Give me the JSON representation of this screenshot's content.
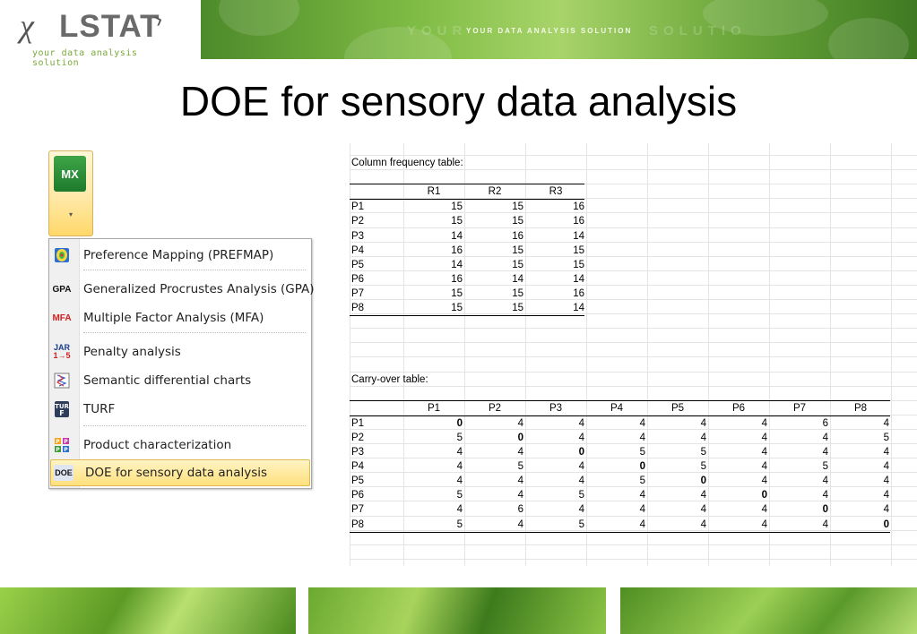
{
  "header": {
    "logo_mark": "χ",
    "logo_text": "LSTAT",
    "logo_tagline": "your data analysis solution",
    "banner_text": "YOUR DATA ANALYSIS SOLUTION"
  },
  "slide_title": "DOE for sensory data analysis",
  "ribbon": {
    "button_label": "MX",
    "caret": "▾"
  },
  "menu": {
    "items": [
      {
        "icon": "prefmap-icon",
        "icon_text": "",
        "label": "Preference Mapping (PREFMAP)"
      },
      {
        "icon": "gpa-icon",
        "icon_text": "GPA",
        "label": "Generalized Procrustes Analysis (GPA)"
      },
      {
        "icon": "mfa-icon",
        "icon_text": "MFA",
        "label": "Multiple Factor Analysis (MFA)"
      },
      {
        "icon": "jar-icon",
        "icon_text": "JAR",
        "icon_sub": "1→5",
        "label": "Penalty analysis"
      },
      {
        "icon": "semantic-chart-icon",
        "icon_text": "",
        "label": "Semantic differential charts"
      },
      {
        "icon": "turf-icon",
        "icon_text": "TUR F",
        "label": "TURF"
      },
      {
        "icon": "product-characterization-icon",
        "icon_text": "P P P P",
        "label": "Product characterization"
      },
      {
        "icon": "doe-icon",
        "icon_text": "DOE",
        "label": "DOE for sensory data analysis"
      }
    ]
  },
  "freq_table": {
    "title": "Column frequency table:",
    "columns": [
      "R1",
      "R2",
      "R3"
    ],
    "rows": [
      {
        "label": "P1",
        "values": [
          "15",
          "15",
          "16"
        ]
      },
      {
        "label": "P2",
        "values": [
          "15",
          "15",
          "16"
        ]
      },
      {
        "label": "P3",
        "values": [
          "14",
          "16",
          "14"
        ]
      },
      {
        "label": "P4",
        "values": [
          "16",
          "15",
          "15"
        ]
      },
      {
        "label": "P5",
        "values": [
          "14",
          "15",
          "15"
        ]
      },
      {
        "label": "P6",
        "values": [
          "16",
          "14",
          "14"
        ]
      },
      {
        "label": "P7",
        "values": [
          "15",
          "15",
          "16"
        ]
      },
      {
        "label": "P8",
        "values": [
          "15",
          "15",
          "14"
        ]
      }
    ]
  },
  "carry_table": {
    "title": "Carry-over table:",
    "columns": [
      "P1",
      "P2",
      "P3",
      "P4",
      "P5",
      "P6",
      "P7",
      "P8"
    ],
    "rows": [
      {
        "label": "P1",
        "values": [
          "0",
          "4",
          "4",
          "4",
          "4",
          "4",
          "6",
          "4"
        ]
      },
      {
        "label": "P2",
        "values": [
          "5",
          "0",
          "4",
          "4",
          "4",
          "4",
          "4",
          "5"
        ]
      },
      {
        "label": "P3",
        "values": [
          "4",
          "4",
          "0",
          "5",
          "5",
          "4",
          "4",
          "4"
        ]
      },
      {
        "label": "P4",
        "values": [
          "4",
          "5",
          "4",
          "0",
          "5",
          "4",
          "5",
          "4"
        ]
      },
      {
        "label": "P5",
        "values": [
          "4",
          "4",
          "4",
          "5",
          "0",
          "4",
          "4",
          "4"
        ]
      },
      {
        "label": "P6",
        "values": [
          "5",
          "4",
          "5",
          "4",
          "4",
          "0",
          "4",
          "4"
        ]
      },
      {
        "label": "P7",
        "values": [
          "4",
          "6",
          "4",
          "4",
          "4",
          "4",
          "0",
          "4"
        ]
      },
      {
        "label": "P8",
        "values": [
          "5",
          "4",
          "5",
          "4",
          "4",
          "4",
          "4",
          "0"
        ]
      }
    ]
  },
  "colors": {
    "accent_green": "#3fa447",
    "menu_highlight": "#ffe07d",
    "tagline_green": "#7aa93a"
  }
}
